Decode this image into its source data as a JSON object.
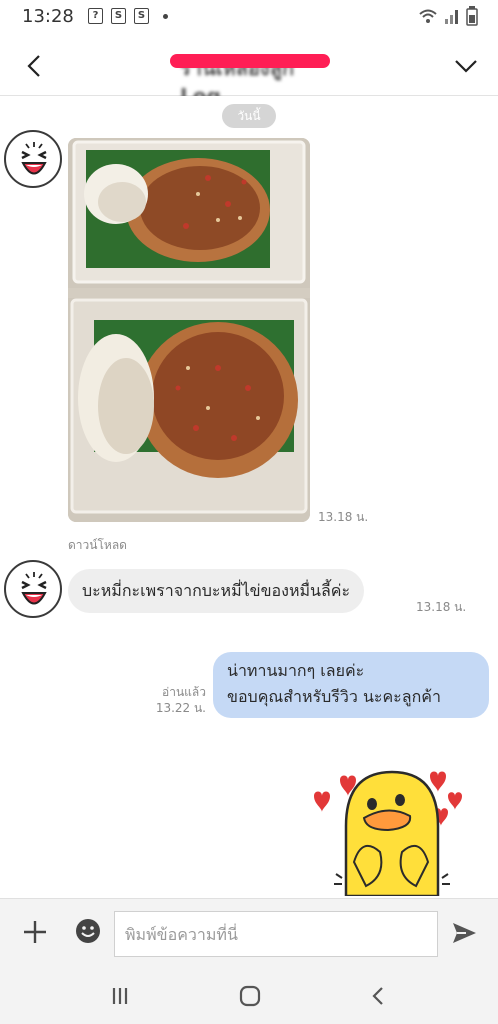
{
  "status_bar": {
    "time": "13:28",
    "icons": [
      "sim-icon",
      "shop-s-icon",
      "shop-bag-icon",
      "dot-icon"
    ],
    "right_icons": [
      "wifi-icon",
      "signal-icon",
      "battery-icon"
    ]
  },
  "header": {
    "title": "ร้านเหลืองลูก Log",
    "back_icon": "chevron-left-icon",
    "menu_icon": "chevron-down-icon"
  },
  "chat": {
    "date_label": "วันนี้",
    "messages": [
      {
        "type": "photo",
        "sender": "other",
        "time": "13.18 น.",
        "caption": "ดาวน์โหลด"
      },
      {
        "type": "text",
        "sender": "other",
        "text": "บะหมี่กะเพราจากบะหมี่ไข่ของหมื่นลี้ค่ะ",
        "time": "13.18 น."
      },
      {
        "type": "text",
        "sender": "me",
        "lines": [
          "น่าทานมากๆ เลยค่ะ",
          "ขอบคุณสำหรับรีวิว นะคะลูกค้า"
        ],
        "read": "อ่านแล้ว",
        "time": "13.22 น."
      },
      {
        "type": "sticker",
        "sender": "me",
        "sticker": "duck-love-sticker"
      }
    ]
  },
  "input_bar": {
    "placeholder": "พิมพ์ข้อความที่นี่",
    "plus_icon": "plus-icon",
    "emoji_icon": "emoji-icon",
    "send_icon": "send-icon"
  },
  "nav_bar": {
    "icons": [
      "recent-apps-icon",
      "home-icon",
      "back-icon"
    ]
  },
  "colors": {
    "outgoing_bubble": "#c5d9f5",
    "incoming_bubble": "#eeeeee",
    "redaction": "#ff1e55"
  }
}
